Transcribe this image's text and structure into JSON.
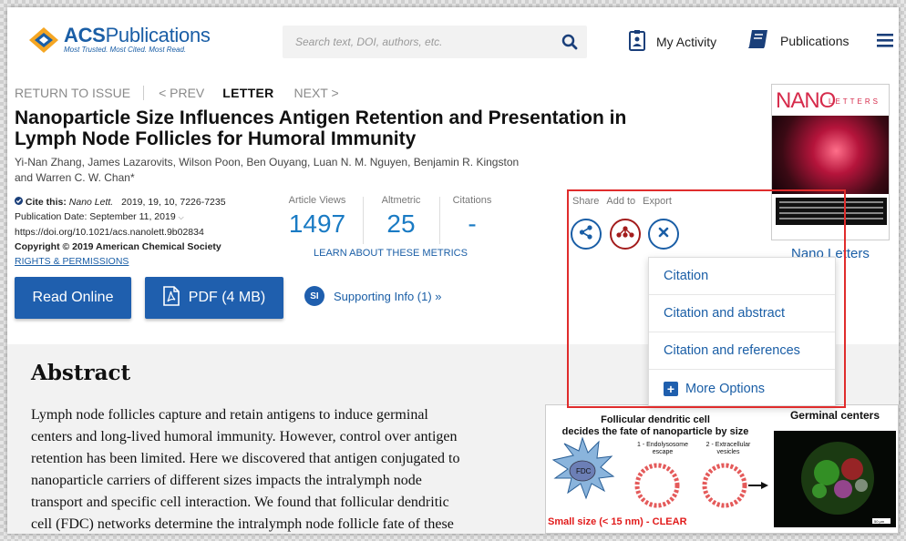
{
  "header": {
    "logo_title_bold": "ACS",
    "logo_title": "Publications",
    "logo_tagline": "Most Trusted. Most Cited. Most Read.",
    "search_placeholder": "Search text, DOI, authors, etc.",
    "my_activity": "My Activity",
    "publications": "Publications",
    "icons": [
      "search-icon",
      "activity-icon",
      "publications-icon",
      "menu-icon"
    ],
    "colors": {
      "brand": "#1a5ea6",
      "accent": "#f5a623"
    }
  },
  "article_nav": {
    "return": "RETURN TO ISSUE",
    "prev": "< PREV",
    "type": "LETTER",
    "next": "NEXT >"
  },
  "article": {
    "title_line1": "Nanoparticle Size Influences Antigen Retention and Presentation in",
    "title_line2": "Lymph Node Follicles for Humoral Immunity",
    "authors_line1": "Yi-Nan Zhang, James Lazarovits, Wilson Poon, Ben Ouyang, Luan N. M. Nguyen, Benjamin R. Kingston",
    "authors_line2": "and Warren C. W. Chan*",
    "cite_label": "Cite this:",
    "cite_journal": "Nano Lett.",
    "cite_ref": "2019, 19, 10, 7226-7235",
    "pub_date": "Publication Date: September 11, 2019",
    "doi": "https://doi.org/10.1021/acs.nanolett.9b02834",
    "copyright": "Copyright © 2019 American Chemical Society",
    "rights": "RIGHTS & PERMISSIONS"
  },
  "metrics": {
    "views_label": "Article Views",
    "views_value": "1497",
    "altmetric_label": "Altmetric",
    "altmetric_value": "25",
    "citations_label": "Citations",
    "citations_value": "-",
    "learn_link": "LEARN ABOUT THESE METRICS"
  },
  "actions": {
    "read_online": "Read Online",
    "pdf": "PDF (4 MB)",
    "si_badge": "SI",
    "supporting_info": "Supporting Info (1) »"
  },
  "tools": {
    "share_label": "Share",
    "add_label": "Add to",
    "export_label": "Export"
  },
  "export_menu": {
    "items": [
      "Citation",
      "Citation and abstract",
      "Citation and references"
    ],
    "more": "More Options"
  },
  "journal": {
    "cover_title": "NANO",
    "cover_sub": "LETTERS",
    "name": "Nano Letters"
  },
  "abstract": {
    "heading": "Abstract",
    "lines": [
      "Lymph node follicles capture and retain antigens to induce germinal",
      "centers and long-lived humoral immunity. However, control over antigen",
      "retention has been limited. Here we discovered that antigen conjugated to",
      "nanoparticle carriers of different sizes impacts the intralymph node",
      "transport and specific cell interaction. We found that follicular dendritic",
      "cell (FDC) networks determine the intralymph node follicle fate of these"
    ]
  },
  "toc_graphic": {
    "head_line1": "Follicular dendritic cell",
    "head_line2": "decides the fate of nanoparticle by size",
    "right_title": "Germinal centers",
    "fdc": "FDC",
    "step1": "1 - Endolysosome escape",
    "step2": "2 - Extracellular vesicles",
    "small_size": "Small size (< 15 nm) - CLEAR",
    "scale": "50 μm"
  }
}
